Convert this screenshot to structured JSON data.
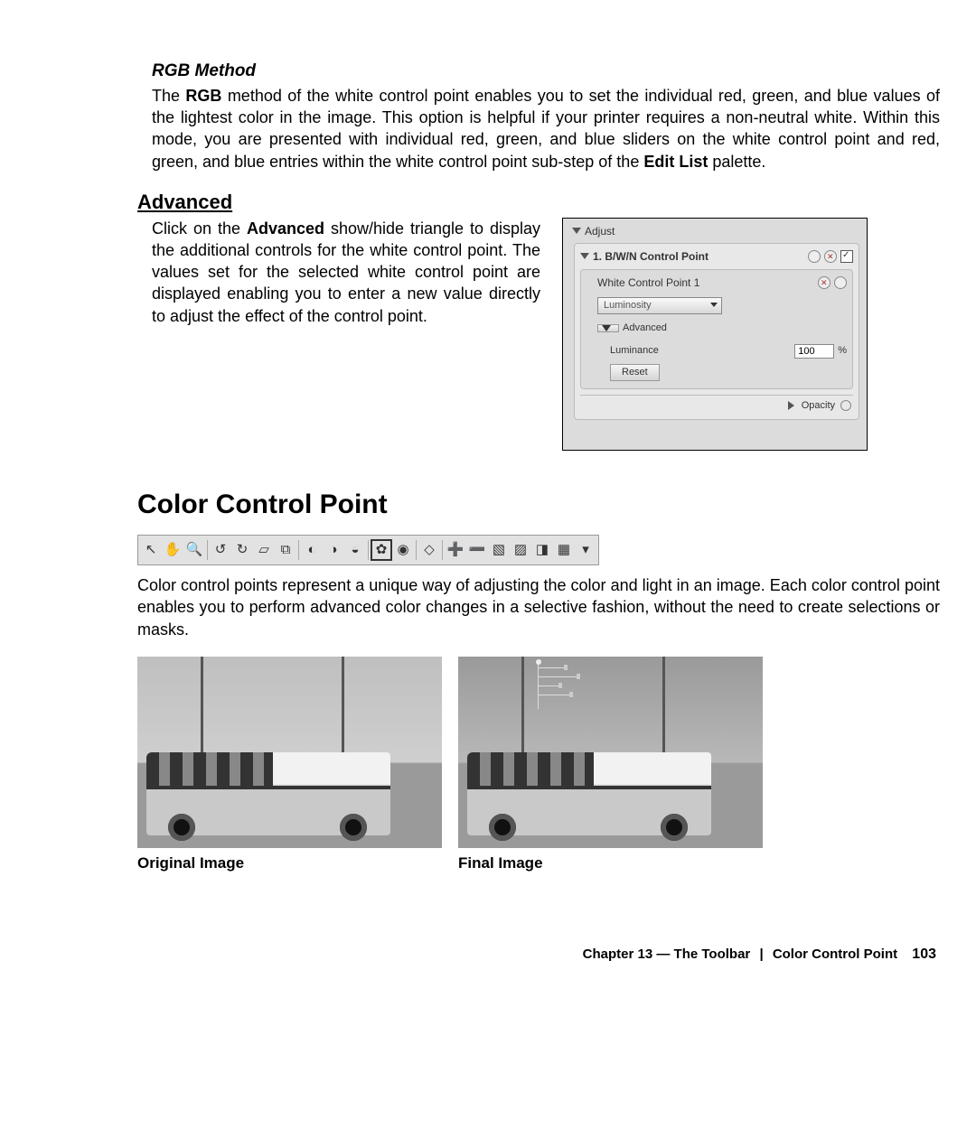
{
  "rgb": {
    "heading": "RGB Method",
    "para_prefix": "The ",
    "para_bold1": "RGB",
    "para_mid": " method of the white control point enables you to set the individual red, green, and blue values of the lightest color in the image. This option is helpful if your printer requires a non-neutral white. Within this mode, you are presented with individual red, green, and blue sliders on the white control point and red, green, and blue entries within the white control point sub-step of the ",
    "para_bold2": "Edit List",
    "para_suffix": " palette."
  },
  "advanced": {
    "heading": "Advanced",
    "para_prefix": "Click on the ",
    "para_bold": "Advanced",
    "para_suffix": " show/hide triangle to display the additional controls for the white control point. The values set for the selected white control point are displayed enabling you to enter a new value directly to adjust the effect of the control point."
  },
  "panel": {
    "adjust": "Adjust",
    "step_label": "1. B/W/N Control Point",
    "sub_label": "White Control Point 1",
    "dropdown_value": "Luminosity",
    "adv_toggle": "Advanced",
    "luminance_label": "Luminance",
    "luminance_value": "100",
    "percent": "%",
    "reset": "Reset",
    "opacity": "Opacity"
  },
  "ccp": {
    "heading": "Color Control Point",
    "para": "Color control points represent a unique way of adjusting the color and light in an image. Each color control point enables you to perform advanced color changes in a selective fashion, without the need to create selections or masks.",
    "caption_original": "Original Image",
    "caption_final": "Final Image"
  },
  "footer": {
    "chapter": "Chapter 13 — The Toolbar",
    "section": "Color Control Point",
    "page": "103"
  }
}
